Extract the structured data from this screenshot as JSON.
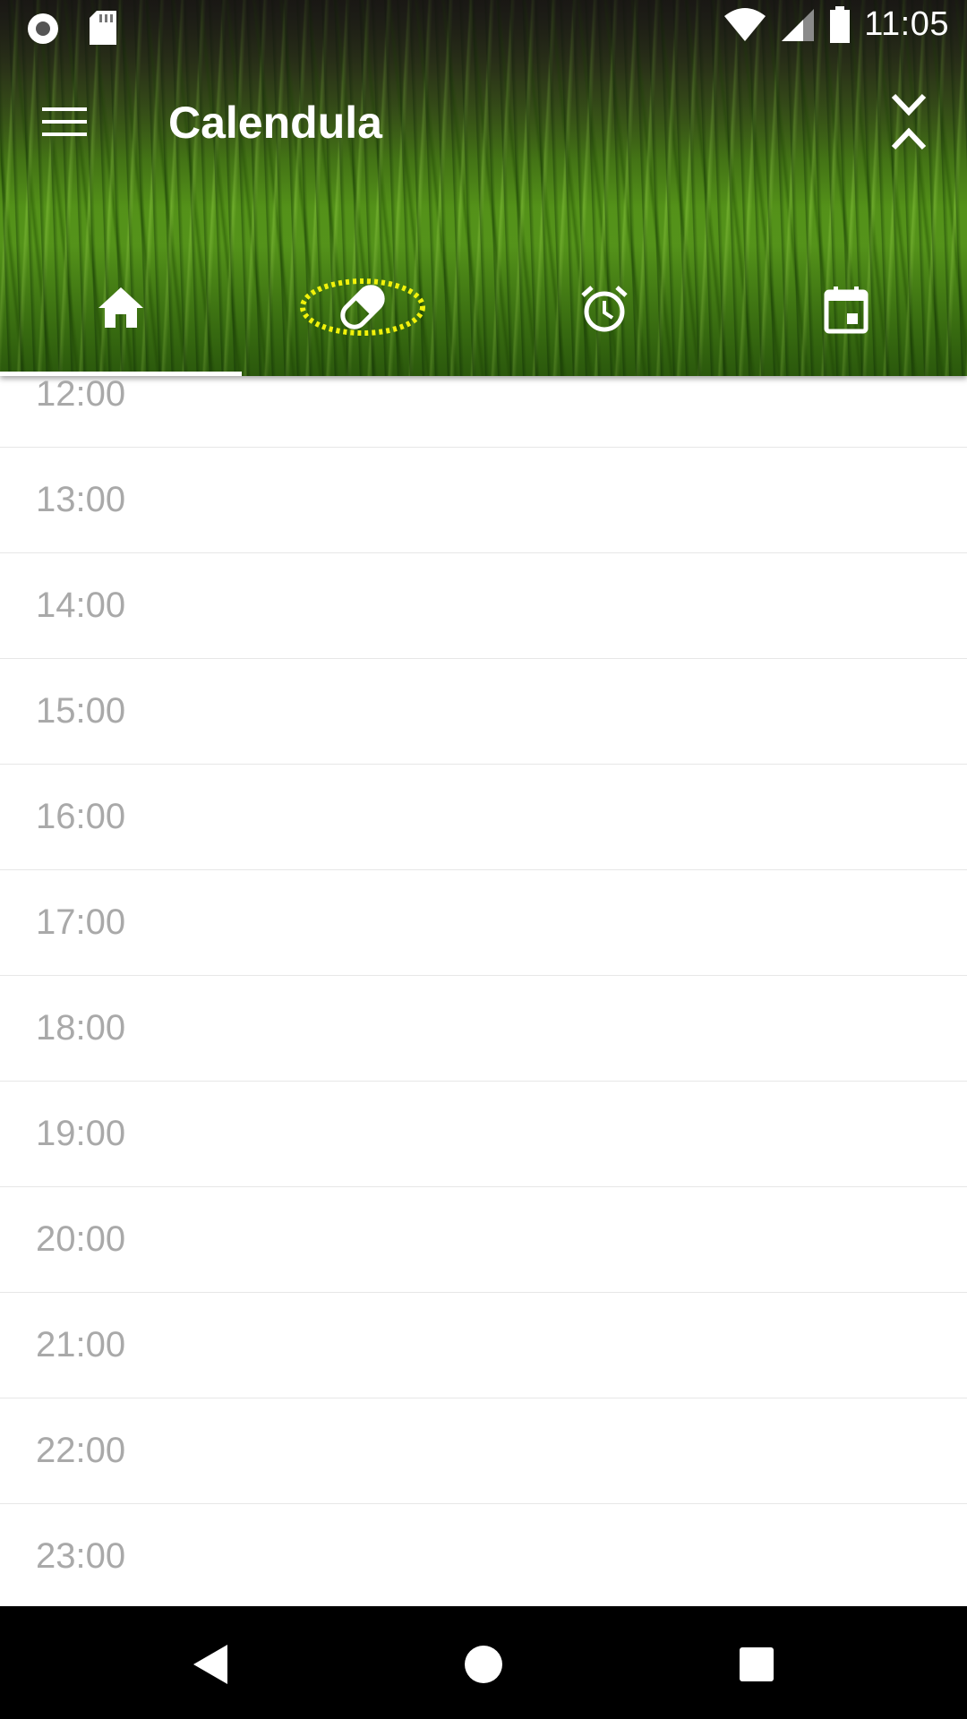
{
  "status_bar": {
    "time": "11:05",
    "left_icons": [
      "record-icon",
      "sd-card-icon"
    ],
    "right_icons": [
      "wifi-icon",
      "signal-icon",
      "battery-icon"
    ]
  },
  "toolbar": {
    "title": "Calendula",
    "menu_icon": "hamburger-menu-icon",
    "collapse_icon": "collapse-icon"
  },
  "tabs": [
    {
      "name": "home",
      "icon": "home-icon",
      "selected": true
    },
    {
      "name": "medicines",
      "icon": "pill-icon",
      "selected": false,
      "highlighted": true
    },
    {
      "name": "routines",
      "icon": "alarm-clock-icon",
      "selected": false
    },
    {
      "name": "schedules",
      "icon": "calendar-icon",
      "selected": false
    }
  ],
  "hours": [
    "12:00",
    "13:00",
    "14:00",
    "15:00",
    "16:00",
    "17:00",
    "18:00",
    "19:00",
    "20:00",
    "21:00",
    "22:00",
    "23:00"
  ],
  "nav_bar": {
    "buttons": [
      "back-icon",
      "home-circle-icon",
      "recents-icon"
    ]
  },
  "colors": {
    "hour_text": "#a9a9a9",
    "divider": "#e7e7e7",
    "highlight_ring": "#f2f20a",
    "nav_background": "#000000"
  }
}
